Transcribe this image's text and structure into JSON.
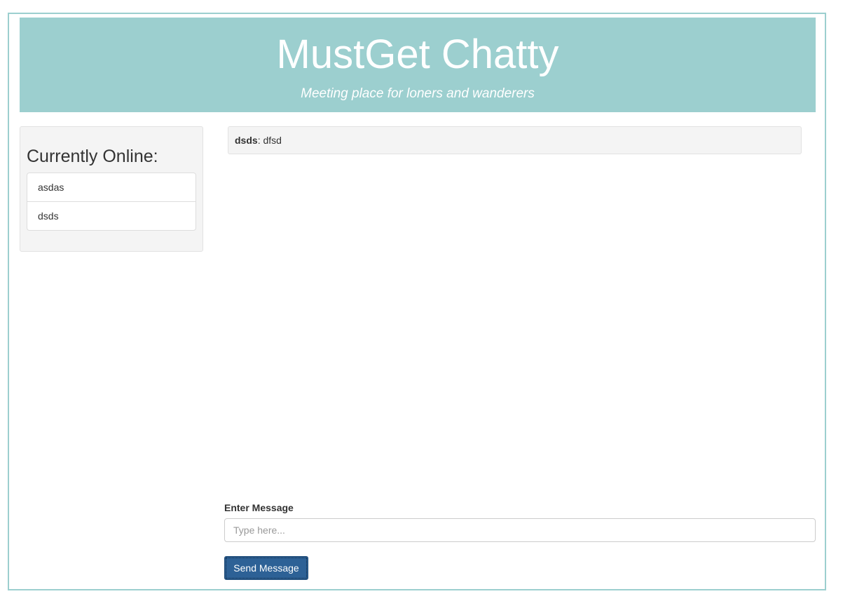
{
  "header": {
    "title": "MustGet Chatty",
    "subtitle": "Meeting place for loners and wanderers"
  },
  "online": {
    "title": "Currently Online:",
    "users": [
      "asdas",
      "dsds"
    ]
  },
  "messages": [
    {
      "user": "dsds",
      "separator": ": ",
      "text": "dfsd"
    }
  ],
  "compose": {
    "label": "Enter Message",
    "placeholder": "Type here...",
    "value": "",
    "send_label": "Send Message"
  },
  "colors": {
    "header_bg": "#9ccfcf",
    "frame_border": "#9ccfcf",
    "button_bg": "#2d6196",
    "panel_bg": "#f4f4f4"
  }
}
